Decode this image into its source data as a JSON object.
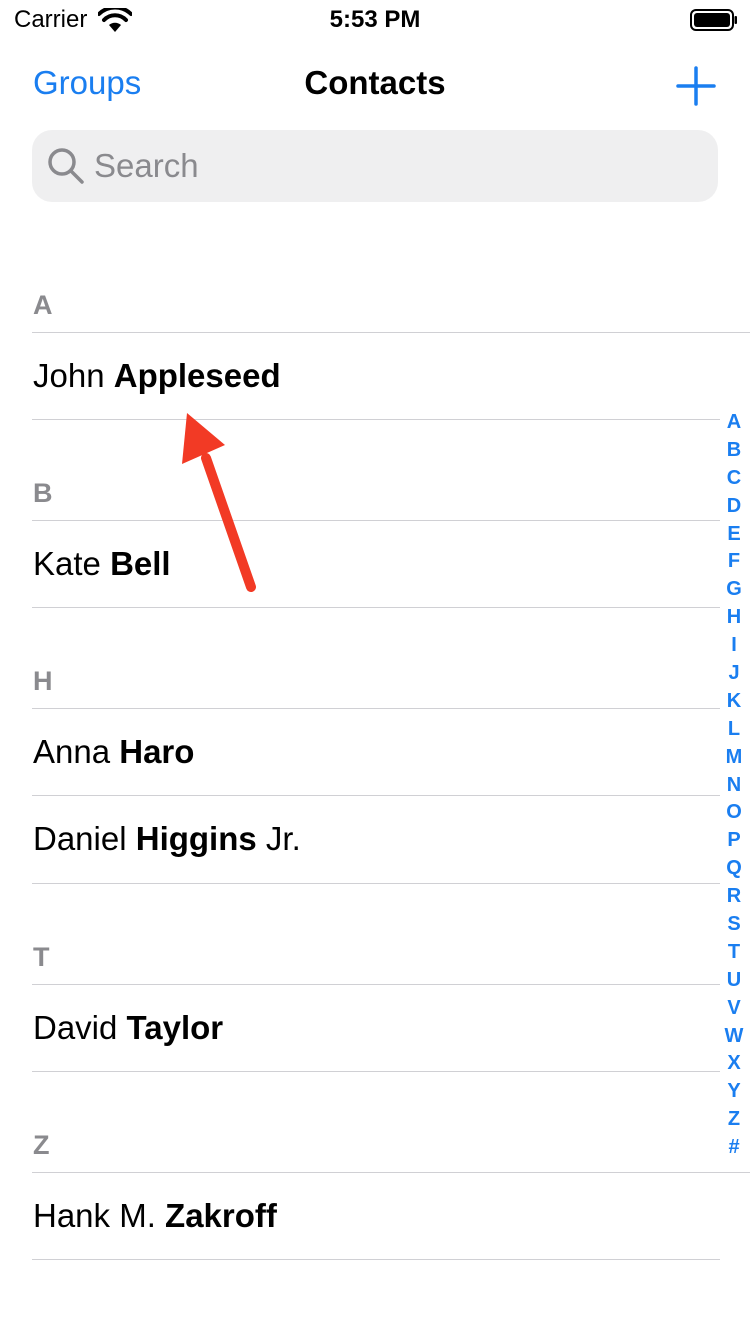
{
  "status_bar": {
    "carrier": "Carrier",
    "time": "5:53 PM"
  },
  "nav": {
    "left_button": "Groups",
    "title": "Contacts",
    "add_icon": "plus-icon"
  },
  "search": {
    "placeholder": "Search",
    "value": ""
  },
  "sections": [
    {
      "letter": "A",
      "contacts": [
        {
          "first": "John",
          "last": "Appleseed",
          "suffix": ""
        }
      ]
    },
    {
      "letter": "B",
      "contacts": [
        {
          "first": "Kate",
          "last": "Bell",
          "suffix": ""
        }
      ]
    },
    {
      "letter": "H",
      "contacts": [
        {
          "first": "Anna",
          "last": "Haro",
          "suffix": ""
        },
        {
          "first": "Daniel",
          "last": "Higgins",
          "suffix": "Jr."
        }
      ]
    },
    {
      "letter": "T",
      "contacts": [
        {
          "first": "David",
          "last": "Taylor",
          "suffix": ""
        }
      ]
    },
    {
      "letter": "Z",
      "contacts": [
        {
          "first": "Hank M.",
          "last": "Zakroff",
          "suffix": ""
        }
      ]
    }
  ],
  "index_letters": [
    "A",
    "B",
    "C",
    "D",
    "E",
    "F",
    "G",
    "H",
    "I",
    "J",
    "K",
    "L",
    "M",
    "N",
    "O",
    "P",
    "Q",
    "R",
    "S",
    "T",
    "U",
    "V",
    "W",
    "X",
    "Y",
    "Z",
    "#"
  ],
  "colors": {
    "accent": "#1a7ef0",
    "section_header": "#8a8a8e",
    "search_bg": "#efeff0",
    "annotation": "#f23a25"
  }
}
